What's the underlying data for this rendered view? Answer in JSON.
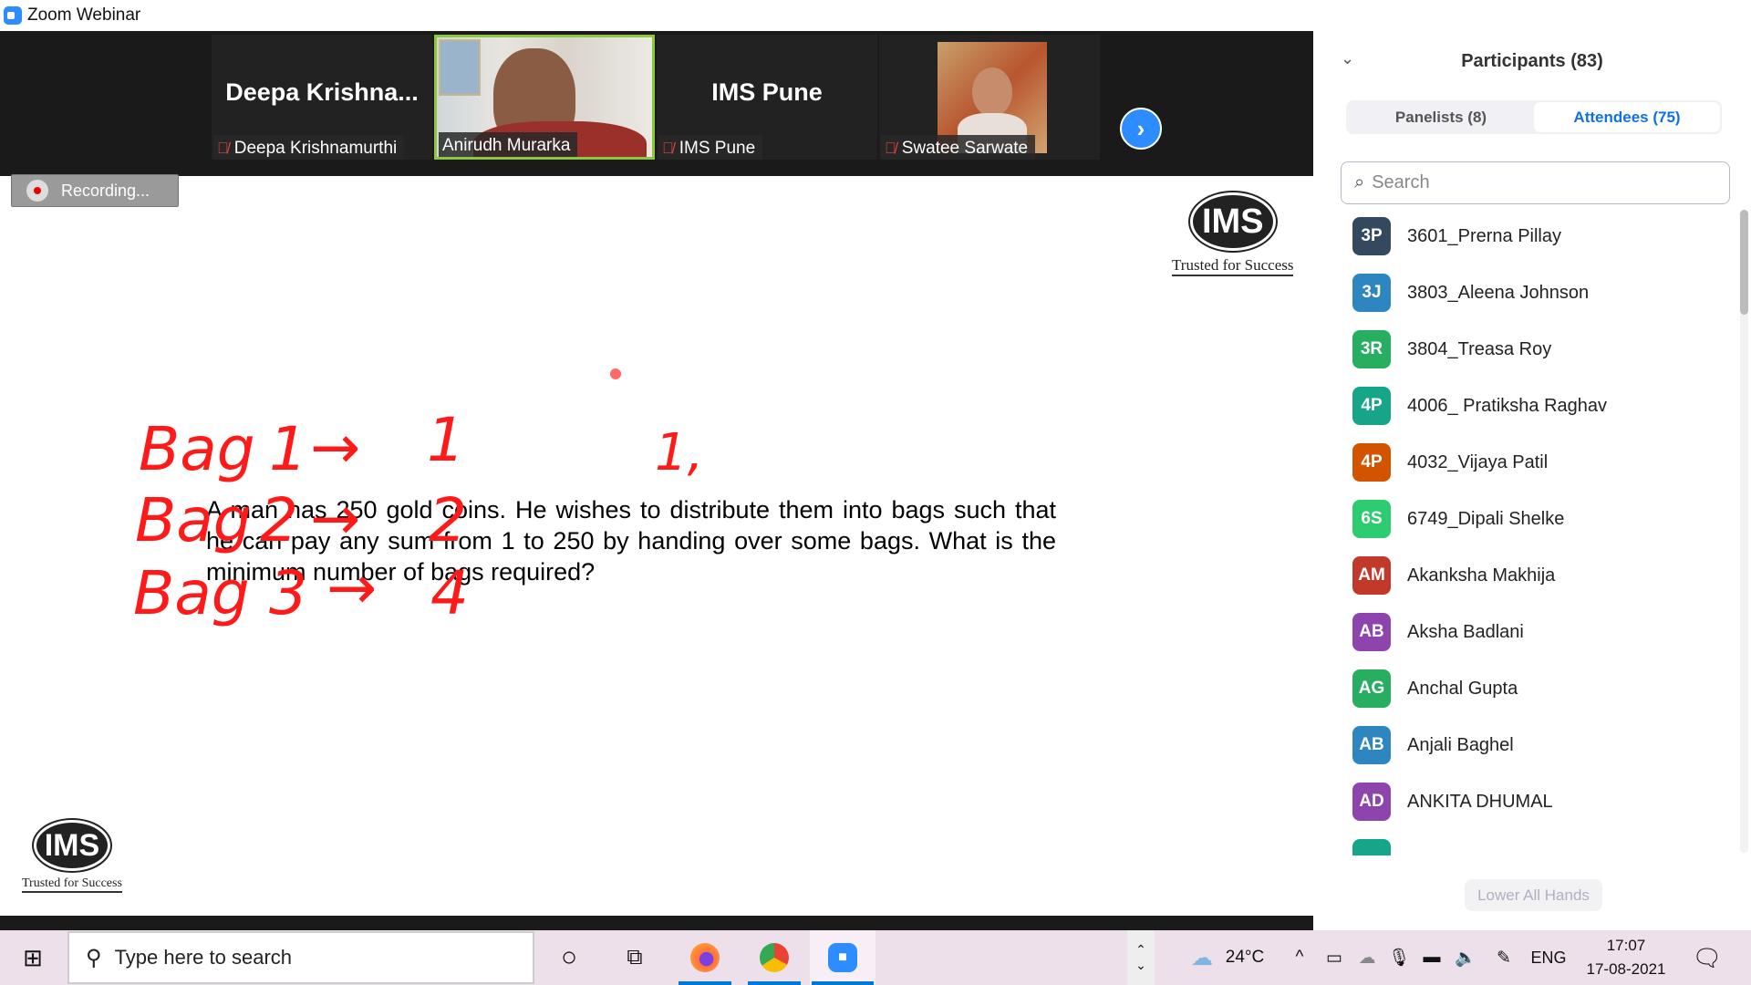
{
  "window": {
    "title": "Zoom Webinar",
    "app_icon": "zoom-icon",
    "controls": [
      "minimize",
      "restore",
      "close"
    ]
  },
  "video_strip": {
    "tiles": [
      {
        "big_name": "Deepa  Krishna...",
        "name": "Deepa Krishnamurthi",
        "muted": true,
        "video": false
      },
      {
        "name": "Anirudh Murarka",
        "muted": false,
        "video": true,
        "active_speaker": true
      },
      {
        "big_name": "IMS Pune",
        "name": "IMS Pune",
        "muted": true,
        "video": false
      },
      {
        "name": "Swatee Sarwate",
        "muted": true,
        "video": true
      }
    ],
    "next_icon": "chevron-right-icon"
  },
  "recording": {
    "label": "Recording..."
  },
  "slide": {
    "logo_text": "IMS",
    "logo_tagline": "Trusted for Success",
    "question": "A man has 250 gold coins. He wishes to distribute them into bags such that he can pay any sum from 1 to 250 by handing over some bags. What is the minimum number of bags required?",
    "annotations": [
      {
        "label": "Bag",
        "left": "1",
        "right": "1"
      },
      {
        "label": "Bag",
        "left": "2",
        "right": "2"
      },
      {
        "label": "Bag",
        "left": "3",
        "right": "4"
      }
    ],
    "scribble": "1,",
    "arrow": "→",
    "ink_color": "#ff1a1a"
  },
  "participants": {
    "title": "Participants (83)",
    "tabs": [
      {
        "label": "Panelists (8)",
        "active": false
      },
      {
        "label": "Attendees (75)",
        "active": true
      }
    ],
    "search_placeholder": "Search",
    "items": [
      {
        "initials": "3P",
        "name": "3601_Prerna Pillay",
        "color": "#34495e"
      },
      {
        "initials": "3J",
        "name": "3803_Aleena Johnson",
        "color": "#2e86c1"
      },
      {
        "initials": "3R",
        "name": "3804_Treasa Roy",
        "color": "#27ae60"
      },
      {
        "initials": "4P",
        "name": "4006_ Pratiksha Raghav",
        "color": "#17a589"
      },
      {
        "initials": "4P",
        "name": "4032_Vijaya Patil",
        "color": "#d35400"
      },
      {
        "initials": "6S",
        "name": "6749_Dipali Shelke",
        "color": "#2ecc71"
      },
      {
        "initials": "AM",
        "name": "Akanksha Makhija",
        "color": "#c0392b"
      },
      {
        "initials": "AB",
        "name": "Aksha Badlani",
        "color": "#8e44ad"
      },
      {
        "initials": "AG",
        "name": "Anchal Gupta",
        "color": "#27ae60"
      },
      {
        "initials": "AB",
        "name": "Anjali Baghel",
        "color": "#2e86c1"
      },
      {
        "initials": "AD",
        "name": "ANKITA DHUMAL",
        "color": "#8e44ad"
      },
      {
        "initials": "",
        "name": "",
        "color": "#17a589"
      }
    ],
    "lower_all_hands": "Lower All Hands"
  },
  "taskbar": {
    "search_placeholder": "Type here to search",
    "apps": [
      "cortana-icon",
      "task-view-icon",
      "firefox-icon",
      "chrome-icon",
      "zoom-icon"
    ],
    "weather": "24°C",
    "language": "ENG",
    "time": "17:07",
    "date": "17-08-2021"
  }
}
